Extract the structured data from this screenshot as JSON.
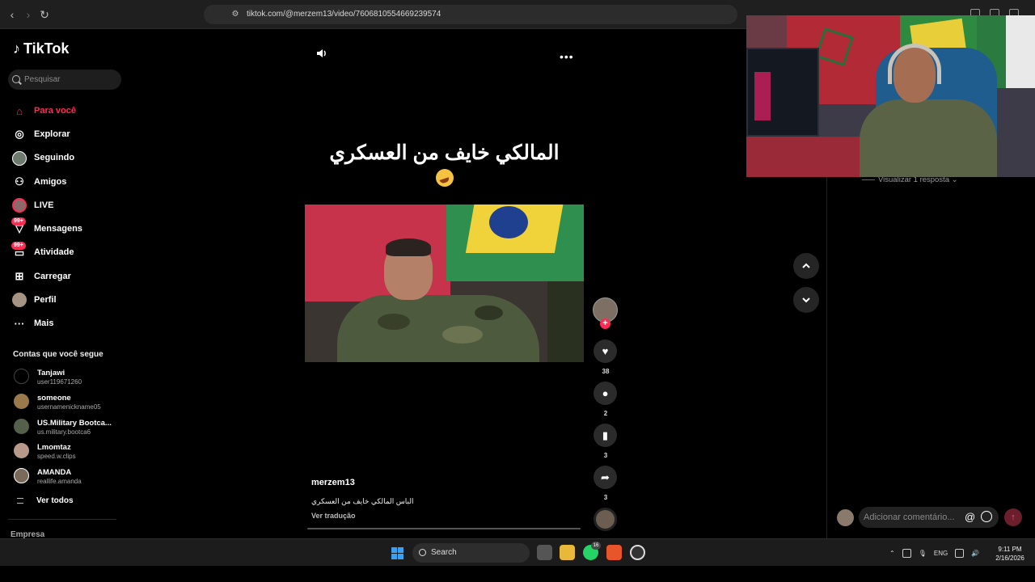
{
  "browser": {
    "url": "tiktok.com/@merzem13/video/7606810554669239574"
  },
  "sidebar": {
    "logo": "TikTok",
    "search_placeholder": "Pesquisar",
    "menu": [
      {
        "label": "Para você",
        "icon": "home-icon",
        "active": true
      },
      {
        "label": "Explorar",
        "icon": "compass-icon"
      },
      {
        "label": "Seguindo",
        "icon": "following-avatar-icon"
      },
      {
        "label": "Amigos",
        "icon": "friends-icon"
      },
      {
        "label": "LIVE",
        "icon": "live-icon"
      },
      {
        "label": "Mensagens",
        "icon": "messages-icon",
        "badge": "99+"
      },
      {
        "label": "Atividade",
        "icon": "activity-icon",
        "badge": "99+"
      },
      {
        "label": "Carregar",
        "icon": "upload-icon"
      },
      {
        "label": "Perfil",
        "icon": "profile-icon"
      },
      {
        "label": "Mais",
        "icon": "more-icon"
      }
    ],
    "following_title": "Contas que você segue",
    "following": [
      {
        "name": "Tanjawi",
        "username": "user119671260"
      },
      {
        "name": "someone",
        "username": "usernamenickname05"
      },
      {
        "name": "US.Military Bootca...",
        "username": "us.military.bootca6"
      },
      {
        "name": "Lmomtaz",
        "username": "speed.w.clips"
      },
      {
        "name": "AMANDA",
        "username": "reallife.amanda"
      }
    ],
    "see_all": "Ver todos",
    "company": "Empresa"
  },
  "video": {
    "overlay_text": "المالكي خايف من العسكري",
    "author": "merzem13",
    "description": "الباس  المالكي خايف من العسكري",
    "translate": "Ver tradução"
  },
  "actions": {
    "likes": "38",
    "comments": "2",
    "saves": "3",
    "shares": "3"
  },
  "comments": {
    "view_replies": "Visualizar 1 resposta ⌄",
    "input_placeholder": "Adicionar comentário...",
    "at_symbol": "@"
  },
  "taskbar": {
    "search": "Search",
    "whatsapp_badge": "16",
    "language": "ENG",
    "time": "9:11 PM",
    "date": "2/16/2026"
  },
  "colors": {
    "accent": "#fe2c55",
    "background": "#000000"
  }
}
